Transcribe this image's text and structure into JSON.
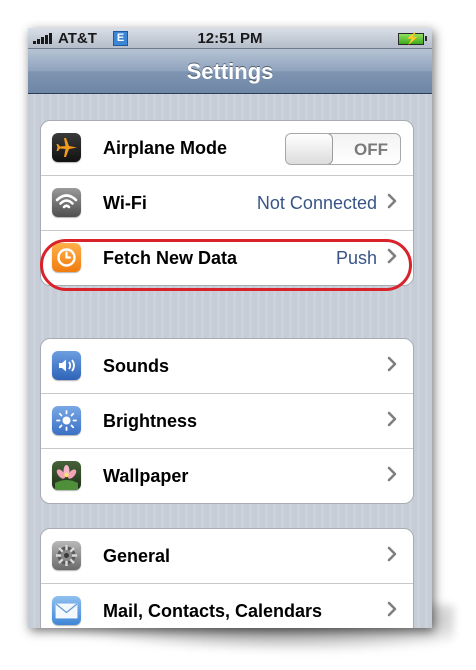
{
  "status_bar": {
    "carrier": "AT&T",
    "network": "E",
    "time": "12:51 PM",
    "battery_icon": "battery-charging-icon"
  },
  "nav": {
    "title": "Settings"
  },
  "groups": [
    {
      "rows": [
        {
          "label": "Airplane Mode",
          "icon": "airplane-icon",
          "toggle": "OFF"
        },
        {
          "label": "Wi-Fi",
          "icon": "wifi-icon",
          "value": "Not Connected",
          "highlighted": true
        },
        {
          "label": "Fetch New Data",
          "icon": "clock-icon",
          "value": "Push"
        }
      ]
    },
    {
      "rows": [
        {
          "label": "Sounds",
          "icon": "speaker-icon"
        },
        {
          "label": "Brightness",
          "icon": "sun-icon"
        },
        {
          "label": "Wallpaper",
          "icon": "flower-icon"
        }
      ]
    },
    {
      "rows": [
        {
          "label": "General",
          "icon": "gear-icon"
        },
        {
          "label": "Mail, Contacts, Calendars",
          "icon": "envelope-icon"
        },
        {
          "label": "",
          "icon": "green-app-icon"
        }
      ]
    }
  ],
  "colors": {
    "value_text": "#385487",
    "highlight": "#d8232a",
    "nav_gradient_top": "#b6c3d4",
    "nav_gradient_bottom": "#6f86a6"
  }
}
